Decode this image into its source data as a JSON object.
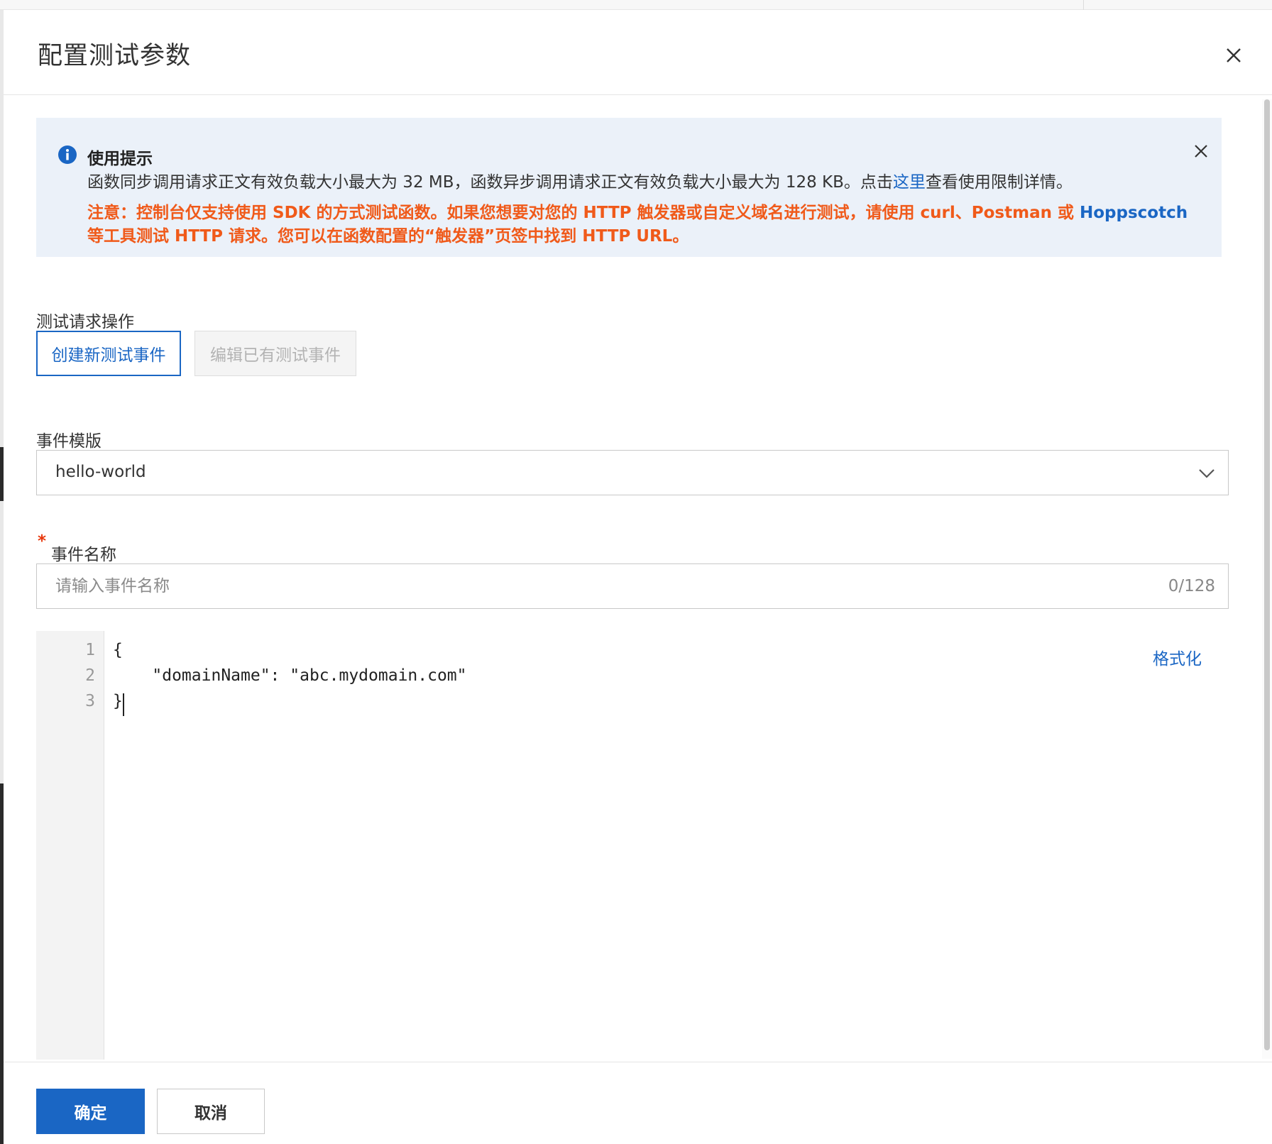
{
  "dialog": {
    "title": "配置测试参数"
  },
  "alert": {
    "title": "使用提示",
    "desc_before_link": "函数同步调用请求正文有效负载大小最大为 32 MB，函数异步调用请求正文有效负载大小最大为 128 KB。点击",
    "desc_link": "这里",
    "desc_after_link": "查看使用限制详情。",
    "warning_part1": "注意：控制台仅支持使用 SDK 的方式测试函数。如果您想要对您的 HTTP 触发器或自定义域名进行测试，请使用 curl、Postman 或 ",
    "warning_highlight": "Hoppscotch",
    "warning_part2": " 等工具测试 HTTP 请求。您可以在函数配置的“触发器”页签中找到 HTTP URL。"
  },
  "test_action": {
    "label": "测试请求操作",
    "create_button": "创建新测试事件",
    "edit_button": "编辑已有测试事件"
  },
  "event_template": {
    "label": "事件模版",
    "selected_value": "hello-world"
  },
  "event_name": {
    "required_mark": "*",
    "label": "事件名称",
    "placeholder": "请输入事件名称",
    "value": "",
    "counter": "0/128"
  },
  "editor": {
    "format_label": "格式化",
    "line_numbers": [
      "1",
      "2",
      "3"
    ],
    "lines": [
      "{",
      "    \"domainName\": \"abc.mydomain.com\"",
      "}"
    ]
  },
  "footer": {
    "confirm_button": "确定",
    "cancel_button": "取消"
  },
  "colors": {
    "primary": "#1a66c4",
    "warning": "#f05a1a",
    "alert_bg": "#ebf1f9",
    "required": "#e8380d"
  },
  "icons": {
    "dialog_close": "close-icon",
    "alert_info": "info-icon",
    "alert_close": "close-icon",
    "select_arrow": "chevron-down-icon"
  }
}
